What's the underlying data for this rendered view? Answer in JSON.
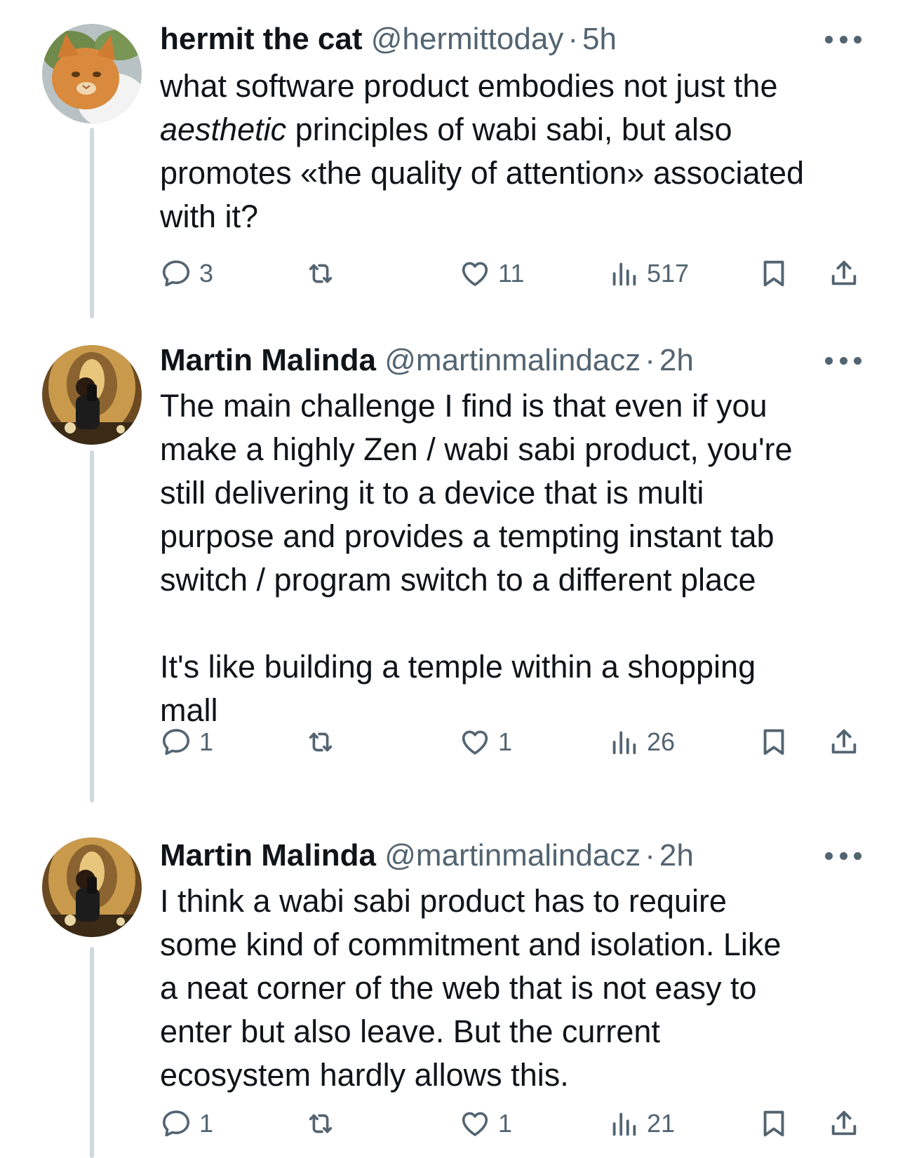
{
  "tweets": [
    {
      "name": "hermit the cat",
      "handle": "@hermittoday",
      "separator": "·",
      "time": "5h",
      "body": {
        "line1": "what software product embodies not just the",
        "line2_italic": "aesthetic",
        "line2_rest": " principles of wabi sabi, but also",
        "line3": "promotes «the quality of attention» associated",
        "line4": "with it?"
      },
      "stats": {
        "replies": "3",
        "reposts": "",
        "likes": "11",
        "views": "517"
      }
    },
    {
      "name": "Martin Malinda",
      "handle": "@martinmalindacz",
      "separator": "·",
      "time": "2h",
      "body": {
        "line1": "The main challenge I find is that even if you",
        "line2": "make a highly Zen / wabi sabi product, you're",
        "line3": "still delivering it to a device that is multi",
        "line4": "purpose and provides a tempting instant tab",
        "line5": "switch / program switch to a different place",
        "line6": "It's like building a temple within a shopping",
        "line7": "mall"
      },
      "stats": {
        "replies": "1",
        "reposts": "",
        "likes": "1",
        "views": "26"
      }
    },
    {
      "name": "Martin Malinda",
      "handle": "@martinmalindacz",
      "separator": "·",
      "time": "2h",
      "body": {
        "line1": "I think a wabi sabi product has to require",
        "line2": "some kind of commitment and isolation. Like",
        "line3": "a neat corner of the web that is not easy to",
        "line4": "enter but also leave. But the current",
        "line5": "ecosystem hardly allows this."
      },
      "stats": {
        "replies": "1",
        "reposts": "",
        "likes": "1",
        "views": "21"
      }
    }
  ],
  "icons": {
    "reply": "speech-bubble-icon",
    "repost": "repost-arrows-icon",
    "like": "heart-icon",
    "views": "bar-chart-icon",
    "bookmark": "bookmark-icon",
    "share": "share-upload-icon",
    "more": "more-horizontal-icon"
  },
  "colors": {
    "text": "#0f1419",
    "secondary": "#536471",
    "thread_line": "#cfd9de"
  }
}
